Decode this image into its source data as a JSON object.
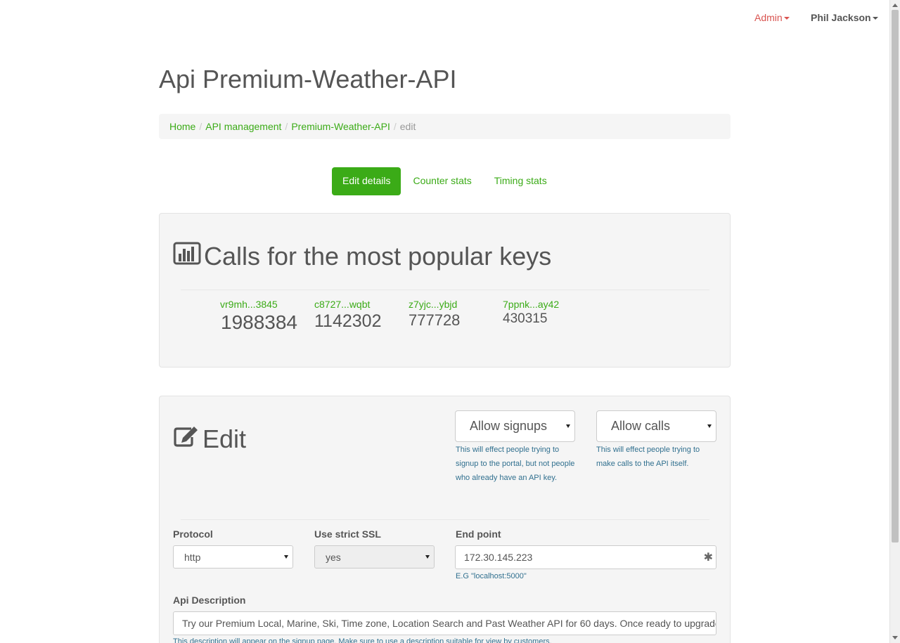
{
  "nav": {
    "admin_label": "Admin",
    "user_label": "Phil Jackson"
  },
  "page": {
    "title": "Api Premium-Weather-API"
  },
  "breadcrumb": {
    "items": [
      "Home",
      "API management",
      "Premium-Weather-API"
    ],
    "active": "edit"
  },
  "tabs": [
    {
      "label": "Edit details",
      "active": true
    },
    {
      "label": "Counter stats",
      "active": false
    },
    {
      "label": "Timing stats",
      "active": false
    }
  ],
  "stats": {
    "title": "Calls for the most popular keys",
    "icon": "bar-chart-icon",
    "keys": [
      {
        "name": "vr9mh...3845",
        "count": "1988384"
      },
      {
        "name": "c8727...wqbt",
        "count": "1142302"
      },
      {
        "name": "z7yjc...ybjd",
        "count": "777728"
      },
      {
        "name": "7ppnk...ay42",
        "count": "430315"
      }
    ]
  },
  "edit": {
    "title": "Edit",
    "icon": "edit-icon",
    "signups_select": "Allow signups",
    "signups_help": "This will effect people trying to signup to the portal, but not people who already have an API key.",
    "calls_select": "Allow calls",
    "calls_help": "This will effect people trying to make calls to the API itself.",
    "protocol_label": "Protocol",
    "protocol_value": "http",
    "ssl_label": "Use strict SSL",
    "ssl_value": "yes",
    "endpoint_label": "End point",
    "endpoint_value": "172.30.145.223",
    "endpoint_help": "E.G \"localhost:5000\"",
    "description_label": "Api Description",
    "description_value": "Try our Premium Local, Marine, Ski, Time zone, Location Search and Past Weather API for 60 days. Once ready to upgrade",
    "description_help": "This description will appear on the signup page. Make sure to use a description suitable for view by customers."
  },
  "colors": {
    "accent": "#3bab17",
    "admin": "#d9534f",
    "help": "#31708f"
  }
}
